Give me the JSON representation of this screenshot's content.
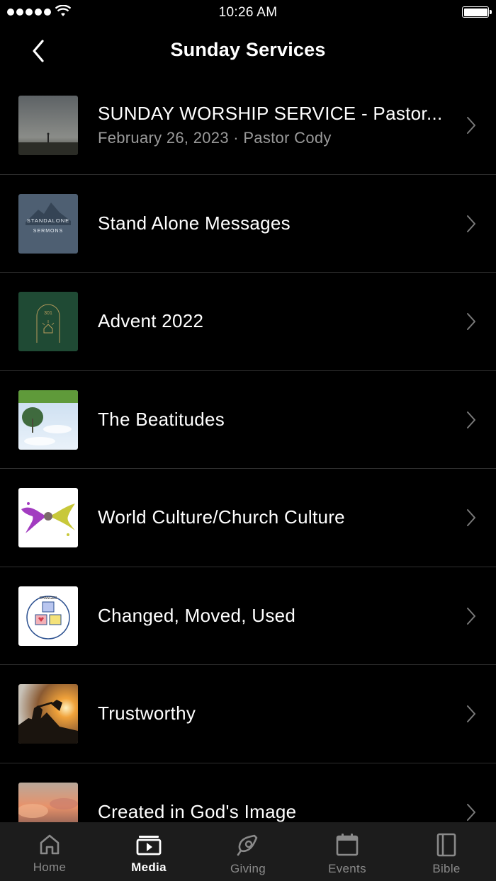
{
  "status_bar": {
    "time": "10:26 AM"
  },
  "nav": {
    "title": "Sunday Services"
  },
  "items": [
    {
      "title": "SUNDAY WORSHIP SERVICE - Pastor...",
      "subtitle": "February 26, 2023 · Pastor Cody",
      "thumb_text": ""
    },
    {
      "title": "Stand Alone Messages",
      "subtitle": "",
      "thumb_text": "STANDALONE",
      "thumb_text2": "SERMONS"
    },
    {
      "title": "Advent 2022",
      "subtitle": "",
      "thumb_text": "301"
    },
    {
      "title": "The Beatitudes",
      "subtitle": ""
    },
    {
      "title": "World Culture/Church Culture",
      "subtitle": ""
    },
    {
      "title": "Changed, Moved, Used",
      "subtitle": "",
      "thumb_text": "CHANGED"
    },
    {
      "title": "Trustworthy",
      "subtitle": ""
    },
    {
      "title": "Created in God's Image",
      "subtitle": ""
    }
  ],
  "tabs": [
    {
      "label": "Home",
      "icon": "home-icon",
      "active": false
    },
    {
      "label": "Media",
      "icon": "media-icon",
      "active": true
    },
    {
      "label": "Giving",
      "icon": "giving-icon",
      "active": false
    },
    {
      "label": "Events",
      "icon": "events-icon",
      "active": false
    },
    {
      "label": "Bible",
      "icon": "bible-icon",
      "active": false
    }
  ]
}
